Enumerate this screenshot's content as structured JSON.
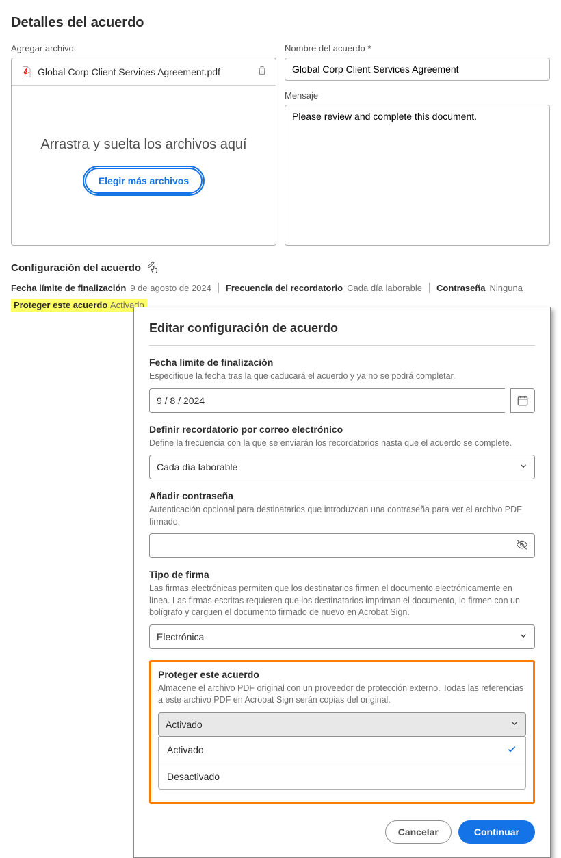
{
  "header": {
    "title": "Detalles del acuerdo"
  },
  "file_area": {
    "label": "Agregar archivo",
    "file_name": "Global Corp Client Services Agreement.pdf",
    "drop_text": "Arrastra y suelta los archivos aquí",
    "choose_button": "Elegir más archivos"
  },
  "agreement": {
    "name_label": "Nombre del acuerdo",
    "star": "*",
    "name_value": "Global Corp Client Services Agreement",
    "msg_label": "Mensaje",
    "msg_value": "Please review and complete this document."
  },
  "config": {
    "heading": "Configuración del acuerdo",
    "deadline_k": "Fecha límite de finalización",
    "deadline_v": "9 de agosto de 2024",
    "reminder_k": "Frecuencia del recordatorio",
    "reminder_v": "Cada día laborable",
    "password_k": "Contraseña",
    "password_v": "Ninguna",
    "vault_k": "Proteger este acuerdo",
    "vault_v": "Activado"
  },
  "panel": {
    "title": "Editar configuración de acuerdo",
    "deadline": {
      "label": "Fecha límite de finalización",
      "desc": "Especifique la fecha tras la que caducará el acuerdo y ya no se podrá completar.",
      "value": "9 /    8 / 2024"
    },
    "reminder": {
      "label": "Definir recordatorio por correo electrónico",
      "desc": "Define la frecuencia con la que se enviarán los recordatorios hasta que el acuerdo se complete.",
      "value": "Cada día laborable"
    },
    "password": {
      "label": "Añadir contraseña",
      "desc": "Autenticación opcional para destinatarios que introduzcan una contraseña para ver el archivo PDF firmado.",
      "value": ""
    },
    "sigtype": {
      "label": "Tipo de firma",
      "desc": "Las firmas electrónicas permiten que los destinatarios firmen el documento electrónicamente en línea. Las firmas escritas requieren que los destinatarios impriman el documento, lo firmen con un bolígrafo y carguen el documento firmado de nuevo en Acrobat Sign.",
      "value": "Electrónica"
    },
    "vault": {
      "label": "Proteger este acuerdo",
      "desc": "Almacene el archivo PDF original con un proveedor de protección externo. Todas las referencias a este archivo PDF en Acrobat Sign serán copias del original.",
      "selected": "Activado",
      "options": [
        "Activado",
        "Desactivado"
      ]
    },
    "footer": {
      "cancel": "Cancelar",
      "continue": "Continuar"
    }
  }
}
